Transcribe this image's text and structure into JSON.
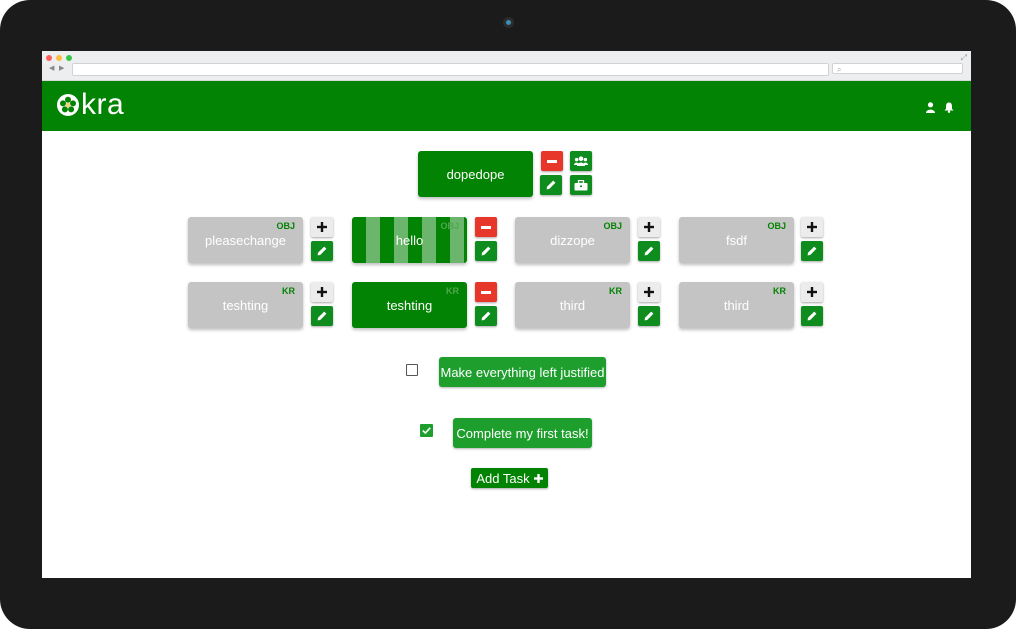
{
  "app": {
    "name": "kra"
  },
  "colors": {
    "brand": "#038303",
    "danger": "#e6372a",
    "card_inactive": "#c4c4c4",
    "tag": "#038303"
  },
  "header": {
    "icons": [
      "user-icon",
      "bell-icon"
    ]
  },
  "root_objective": {
    "label": "dopedope"
  },
  "objectives": [
    {
      "label": "pleasechange",
      "tag": "OBJ",
      "state": "inactive"
    },
    {
      "label": "hello",
      "tag": "OBJ",
      "state": "selected-hover"
    },
    {
      "label": "dizzope",
      "tag": "OBJ",
      "state": "inactive"
    },
    {
      "label": "fsdf",
      "tag": "OBJ",
      "state": "inactive"
    }
  ],
  "key_results": [
    {
      "label": "teshting",
      "tag": "KR",
      "state": "inactive"
    },
    {
      "label": "teshting",
      "tag": "KR",
      "state": "selected"
    },
    {
      "label": "third",
      "tag": "KR",
      "state": "inactive"
    },
    {
      "label": "third",
      "tag": "KR",
      "state": "inactive"
    }
  ],
  "tasks": [
    {
      "label": "Make everything left justified",
      "checked": false
    },
    {
      "label": "Complete my first task!",
      "checked": true
    }
  ],
  "add_task": {
    "label": "Add Task"
  }
}
